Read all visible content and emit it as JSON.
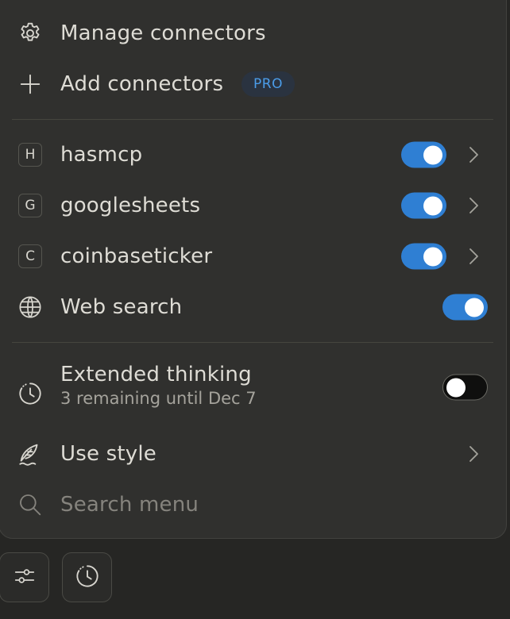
{
  "menu": {
    "manage": {
      "label": "Manage connectors",
      "icon": "gear-icon"
    },
    "add": {
      "label": "Add connectors",
      "icon": "plus-icon",
      "badge": "PRO"
    },
    "connectors": [
      {
        "letter": "H",
        "label": "hasmcp",
        "enabled": true
      },
      {
        "letter": "G",
        "label": "googlesheets",
        "enabled": true
      },
      {
        "letter": "C",
        "label": "coinbaseticker",
        "enabled": true
      }
    ],
    "web_search": {
      "label": "Web search",
      "icon": "globe-icon",
      "enabled": true
    },
    "extended_thinking": {
      "label": "Extended thinking",
      "sublabel": "3 remaining until Dec 7",
      "icon": "clock-icon",
      "enabled": false
    },
    "use_style": {
      "label": "Use style",
      "icon": "feather-icon"
    },
    "search": {
      "placeholder": "Search menu",
      "icon": "search-icon"
    }
  },
  "bottom_bar": {
    "buttons": [
      {
        "icon": "sliders-icon"
      },
      {
        "icon": "clock-icon"
      }
    ]
  },
  "colors": {
    "toggle_on": "#2f7fd3",
    "pro_badge_text": "#4b9ce8",
    "menu_bg": "#30302e"
  }
}
